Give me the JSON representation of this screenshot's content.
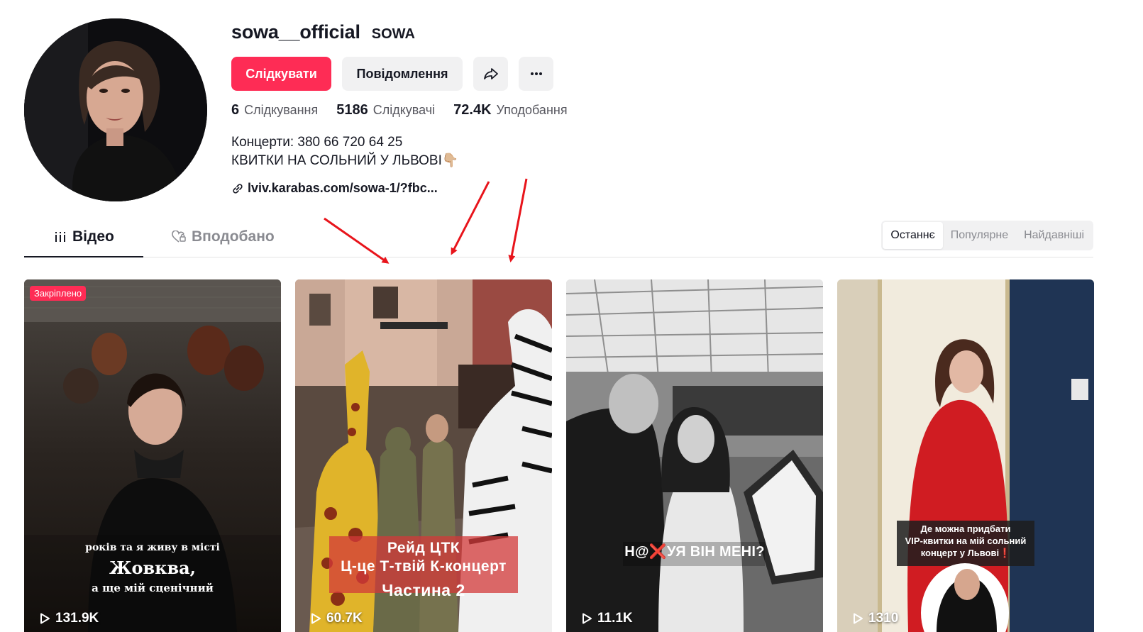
{
  "profile": {
    "username": "sowa__official",
    "nickname": "SOWA",
    "follow_label": "Слідкувати",
    "message_label": "Повідомлення",
    "stats": [
      {
        "value": "6",
        "label": "Слідкування"
      },
      {
        "value": "5186",
        "label": "Слідкувачі"
      },
      {
        "value": "72.4K",
        "label": "Уподобання"
      }
    ],
    "bio_line1": "Концерти: 380 66 720 64 25",
    "bio_line2": "КВИТКИ НА СОЛЬНИЙ У ЛЬВОВІ👇🏼",
    "link": "lviv.karabas.com/sowa-1/?fbc..."
  },
  "tabs": {
    "videos": "Відео",
    "liked": "Вподобано"
  },
  "sort": {
    "options": [
      "Останнє",
      "Популярне",
      "Найдавніші"
    ],
    "active": "Останнє"
  },
  "videos": [
    {
      "pinned_label": "Закріплено",
      "views": "131.9K",
      "caption_line1": "років та я живу в місті",
      "caption_line2": "Жовква,",
      "caption_line3": "а ще мій сценічний"
    },
    {
      "views": "60.7K",
      "caption_line1": "Рейд ЦТК",
      "caption_line2": "Ц-це Т-твій К-концерт",
      "caption_line3": "Частина 2"
    },
    {
      "views": "11.1K",
      "caption_line1": "Н@❌УЯ ВІН МЕНІ?"
    },
    {
      "views": "1310",
      "caption_line1": "Де можна придбати",
      "caption_line2": "VIP-квитки на мій сольний",
      "caption_line3": "концерт у Львові❗"
    }
  ],
  "colors": {
    "accent": "#fe2c55",
    "annotation_arrow": "#e8141b"
  },
  "icons": [
    "share-icon",
    "more-icon",
    "link-icon",
    "grid-icon",
    "heart-lock-icon",
    "play-icon"
  ]
}
